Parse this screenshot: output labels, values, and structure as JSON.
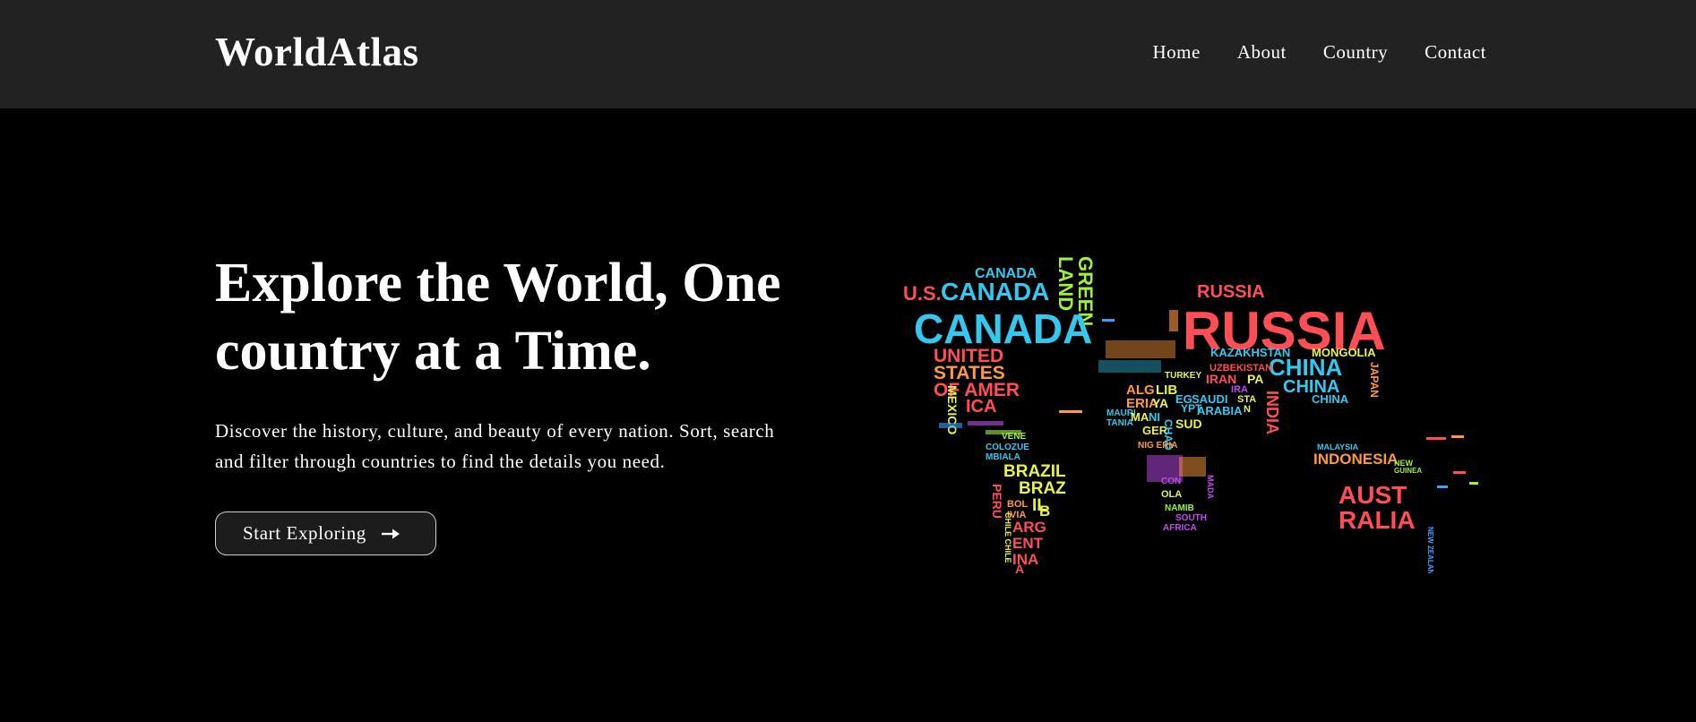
{
  "header": {
    "logo": "WorldAtlas",
    "nav": [
      "Home",
      "About",
      "Country",
      "Contact"
    ]
  },
  "hero": {
    "title": "Explore the World, One country at a Time.",
    "description": "Discover the history, culture, and beauty of every nation. Sort, search and filter through countries to find the details you need.",
    "cta_label": "Start Exploring",
    "cta_icon": "arrow-right-icon"
  },
  "map": {
    "image": "world-map-word-cloud",
    "labels": {
      "greenland_1": "GREEN",
      "greenland_2": "LAND",
      "canada_small": "CANADA",
      "us": "U.S.",
      "canada_mid": "CANADA",
      "canada_big": "CANADA",
      "usa_1": "UNITED",
      "usa_2": "STATES",
      "usa_3": "OF AMER",
      "usa_4": "ICA",
      "mexico": "MEXICO",
      "brazil_1": "BRAZIL",
      "brazil_2": "BRAZ",
      "brazil_3": "IL",
      "argentina_1": "ARG",
      "argentina_2": "ENT",
      "argentina_3": "INA",
      "argentina_4": "A",
      "russia_small": "RUSSIA",
      "russia_big": "RUSSIA",
      "kazakhstan": "KAZAKHSTAN",
      "mongolia": "MONGOLIA",
      "china_1": "CHINA",
      "china_2": "CHINA",
      "china_3": "CHINA",
      "india": "INDIA",
      "japan": "JAPAN",
      "saudi_1": "SAUDI",
      "saudi_2": "ARABIA",
      "algeria_1": "ALG",
      "algeria_2": "ERIA",
      "libya": "LIB",
      "egypt": "EG",
      "indonesia": "INDONESIA",
      "australia_1": "AUST",
      "australia_2": "RALIA",
      "sudan": "SUD",
      "chad": "CHAD",
      "turkey": "TURKEY",
      "iran": "IRAN",
      "south_africa": "AFRICA"
    },
    "colors": {
      "red": "#ff4f55",
      "cyan": "#33c8f0",
      "yellow": "#e8f24a",
      "green": "#9cf23a",
      "orange": "#ff9a3c",
      "purple": "#c04cf0",
      "blue": "#3aa0ff"
    }
  }
}
